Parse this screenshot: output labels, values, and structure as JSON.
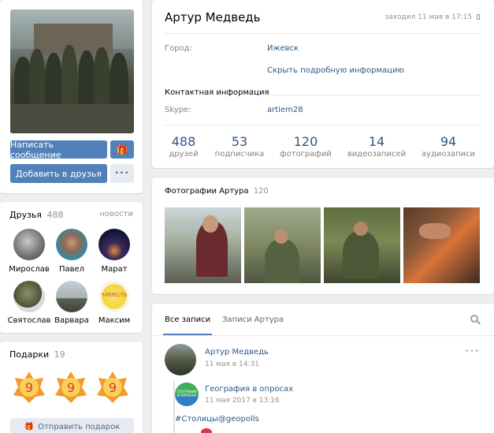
{
  "left": {
    "write_message": "Написать сообщение",
    "add_friend": "Добавить в друзья",
    "more": "•••"
  },
  "friends": {
    "title": "Друзья",
    "count": "488",
    "news_link": "новости",
    "items": [
      {
        "name": "Мирослав"
      },
      {
        "name": "Павел"
      },
      {
        "name": "Марат"
      },
      {
        "name": "Святослав"
      },
      {
        "name": "Варвара"
      },
      {
        "name": "Максим"
      }
    ]
  },
  "gifts": {
    "title": "Подарки",
    "count": "19",
    "send_button": "Отправить подарок"
  },
  "profile": {
    "name": "Артур Медведь",
    "last_seen": "заходил 11 мая в 17:15",
    "city_label": "Город:",
    "city_value": "Ижевск",
    "hide_info": "Скрыть подробную информацию",
    "contacts_title": "Контактная информация",
    "skype_label": "Skype:",
    "skype_value": "artiem28",
    "stats": [
      {
        "value": "488",
        "label": "друзей"
      },
      {
        "value": "53",
        "label": "подписчика"
      },
      {
        "value": "120",
        "label": "фотографий"
      },
      {
        "value": "14",
        "label": "видеозаписей"
      },
      {
        "value": "94",
        "label": "аудиозаписи"
      }
    ]
  },
  "photos": {
    "title": "Фотографии Артура",
    "count": "120"
  },
  "wall": {
    "tab_all": "Все записи",
    "tab_own": "Записи Артура",
    "post": {
      "author": "Артур Медведь",
      "date": "11 мая в 14:31",
      "repost_author": "География в опросах",
      "repost_date": "11 мая 2017 в 13:16",
      "repost_avatar_text": "ГЕОГРАФИЯ В ОПРОСАХ",
      "hashtag": "#Столицы@geopolls"
    }
  },
  "colors": {
    "accent": "#5181b8",
    "link": "#2a5885",
    "background": "#edeef0"
  }
}
